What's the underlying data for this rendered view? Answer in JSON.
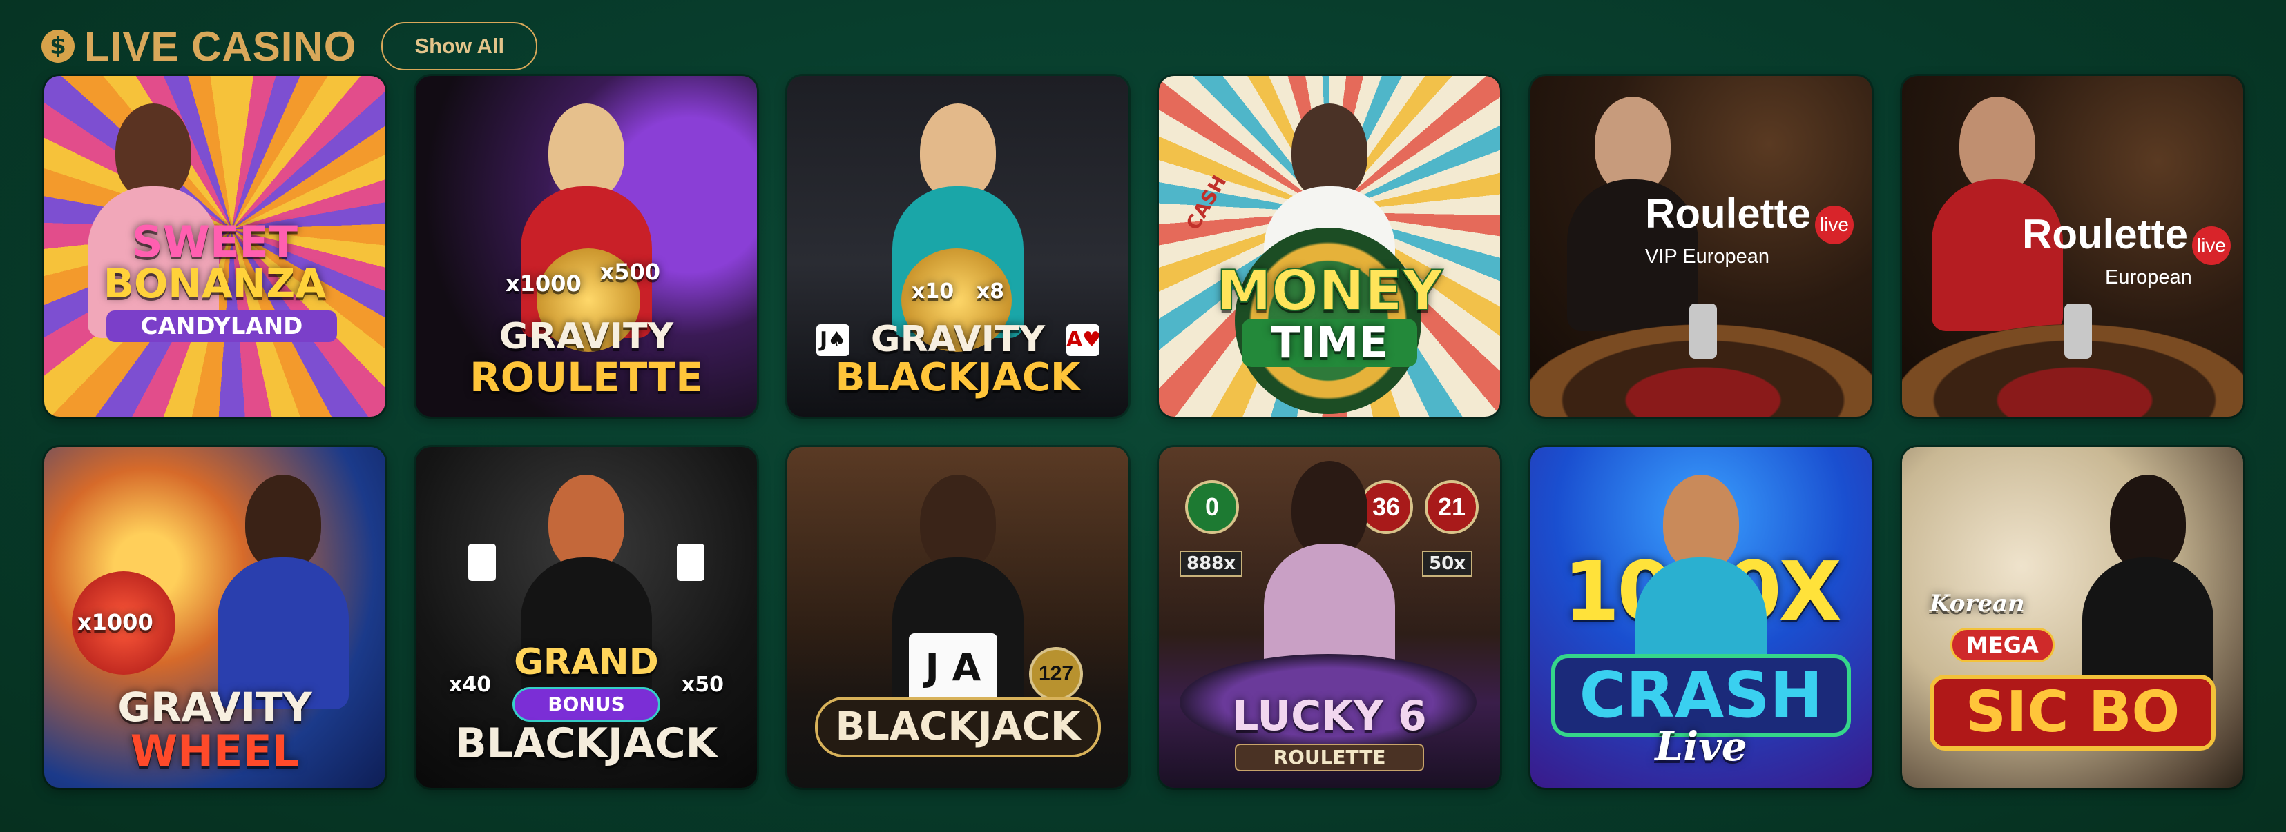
{
  "header": {
    "icon": "dollar-coin-icon",
    "icon_glyph": "$",
    "title": "LIVE CASINO",
    "show_all_label": "Show All"
  },
  "colors": {
    "background": "#073a2a",
    "accent": "#d9a85a"
  },
  "games": [
    {
      "logo_line1": "SWEET",
      "logo_line2": "BONANZA",
      "logo_line3": "CANDYLAND"
    },
    {
      "multiplier_a": "x1000",
      "multiplier_b": "x500",
      "logo_line1": "GRAVITY",
      "logo_line2": "ROULETTE"
    },
    {
      "multiplier_a": "x10",
      "multiplier_b": "x8",
      "logo_line1": "GRAVITY",
      "logo_line2": "BLACKJACK",
      "card_left": "J♠",
      "card_right": "A♥"
    },
    {
      "logo_line1": "MONEY",
      "logo_line2": "TIME",
      "wheel_label": "CASH"
    },
    {
      "logo_line1": "Roulette",
      "badge": "live",
      "logo_line2": "VIP European"
    },
    {
      "logo_line1": "Roulette",
      "badge": "live",
      "logo_line2": "European"
    },
    {
      "multiplier_a": "x1000",
      "logo_line1": "GRAVITY",
      "logo_line2": "WHEEL"
    },
    {
      "multiplier_a": "x40",
      "multiplier_b": "x50",
      "logo_line1": "GRAND",
      "logo_line2": "BONUS",
      "logo_line3": "BLACKJACK"
    },
    {
      "logo_line1": "BLACKJACK",
      "card_label": "J A",
      "chip": "127"
    },
    {
      "numbers": [
        "0",
        "36",
        "21"
      ],
      "multipliers": [
        "888x",
        "50x"
      ],
      "logo_line1": "LUCKY 6",
      "logo_line2": "ROULETTE"
    },
    {
      "logo_line1": "1000X",
      "logo_line2": "CRASH",
      "logo_line3": "Live"
    },
    {
      "logo_line1": "Korean",
      "logo_line2": "MEGA",
      "logo_line3": "SIC BO"
    }
  ]
}
